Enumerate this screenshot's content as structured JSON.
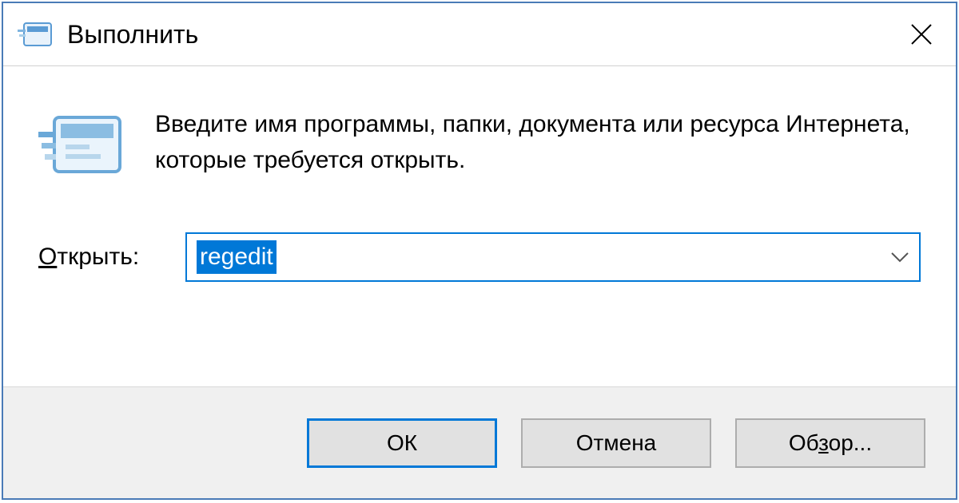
{
  "titlebar": {
    "title": "Выполнить"
  },
  "content": {
    "description": "Введите имя программы, папки, документа или ресурса Интернета, которые требуется открыть.",
    "open_label_underline": "О",
    "open_label_rest": "ткрыть:",
    "input_value": "regedit"
  },
  "footer": {
    "ok_label": "ОК",
    "cancel_label": "Отмена",
    "browse_prefix": "Об",
    "browse_underline": "з",
    "browse_suffix": "ор..."
  }
}
